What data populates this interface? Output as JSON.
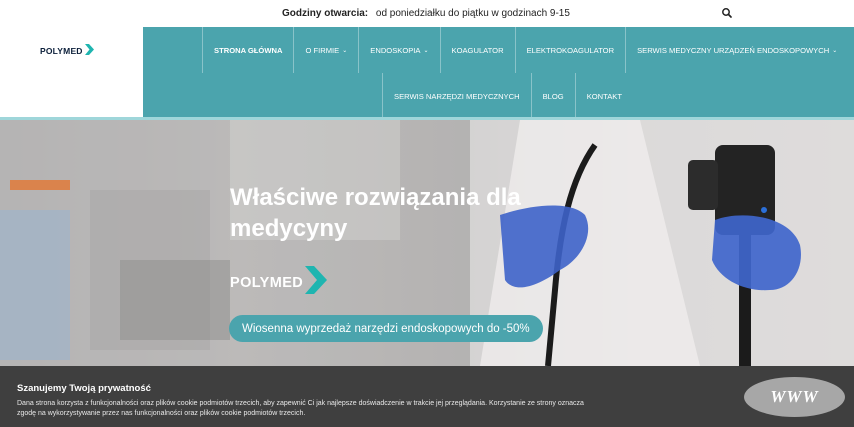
{
  "topbar": {
    "hours_label": "Godziny otwarcia:",
    "hours_value": "od poniedziałku do piątku w godzinach 9-15",
    "search_icon": "search-icon"
  },
  "logo": {
    "text": "POLYMED",
    "mark": "chevron-logo-icon"
  },
  "nav": {
    "row1": [
      {
        "label": "STRONA GŁÓWNA",
        "active": true,
        "caret": ""
      },
      {
        "label": "O FIRMIE",
        "active": false,
        "caret": "⌄"
      },
      {
        "label": "ENDOSKOPIA",
        "active": false,
        "caret": "⌄"
      },
      {
        "label": "KOAGULATOR",
        "active": false,
        "caret": ""
      },
      {
        "label": "ELEKTROKOAGULATOR",
        "active": false,
        "caret": ""
      },
      {
        "label": "SERWIS MEDYCZNY URZĄDZEŃ ENDOSKOPOWYCH",
        "active": false,
        "caret": "⌄"
      }
    ],
    "row2": [
      {
        "label": "SERWIS NARZĘDZI MEDYCZNYCH",
        "active": false,
        "caret": ""
      },
      {
        "label": "BLOG",
        "active": false,
        "caret": ""
      },
      {
        "label": "KONTAKT",
        "active": false,
        "caret": ""
      }
    ]
  },
  "hero": {
    "title": "Właściwe rozwiązania dla medycyny",
    "logo_text": "POLYMED",
    "promo_button": "Wiosenna wyprzedaż narzędzi endoskopowych do -50%"
  },
  "cookie": {
    "title": "Szanujemy Twoją prywatność",
    "text": "Dana strona korzysta z funkcjonalności oraz plików cookie podmiotów trzecich, aby zapewnić Ci jak najlepsze doświadczenie w trakcie jej przeglądania. Korzystanie ze strony oznacza zgodę na wykorzystywanie przez nas funkcjonalności oraz plików cookie podmiotów trzecich."
  },
  "www_badge": "WWW",
  "colors": {
    "brand_teal": "#4ba4ad",
    "logo_accent": "#1fb5b0",
    "cookie_bg": "#3f3f3f"
  }
}
